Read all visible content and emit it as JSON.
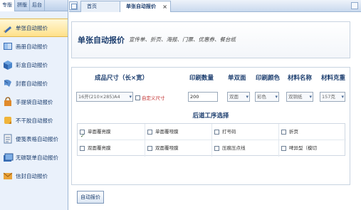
{
  "sidebar": {
    "tabs": [
      {
        "label": "专版"
      },
      {
        "label": "拼版"
      },
      {
        "label": "后台"
      }
    ],
    "items": [
      {
        "label": "单张自动报价",
        "icon": "pencil-icon",
        "active": true
      },
      {
        "label": "画册自动报价",
        "icon": "book-icon"
      },
      {
        "label": "彩盒自动报价",
        "icon": "color-box-icon"
      },
      {
        "label": "封套自动报价",
        "icon": "envelope-icon"
      },
      {
        "label": "手提袋自动报价",
        "icon": "handbag-icon"
      },
      {
        "label": "不干胶自动报价",
        "icon": "sticker-icon"
      },
      {
        "label": "便笺表格自动报价",
        "icon": "notepad-icon"
      },
      {
        "label": "无碳联单自动报价",
        "icon": "carbonless-form-icon"
      },
      {
        "label": "信封自动报价",
        "icon": "letter-envelope-icon"
      }
    ]
  },
  "tabs": [
    {
      "label": "首页"
    },
    {
      "label": "单张自动报价",
      "active": true
    }
  ],
  "page": {
    "title": "单张自动报价",
    "subtitle": "宣传单、折页、海报、门票、优惠券、餐台纸"
  },
  "form": {
    "columns": {
      "size": "成品尺寸（长×宽）",
      "quantity": "印刷数量",
      "sides": "单双面",
      "color": "印刷颜色",
      "material": "材料名称",
      "weight": "材料克重"
    },
    "size_value": "16开(210×285)A4",
    "custom_size_label": "自定义尺寸",
    "quantity_value": "200",
    "sides_value": "双面",
    "color_value": "彩色",
    "material_value": "双铜纸",
    "weight_value": "157克"
  },
  "post_process": {
    "title": "后道工序选择",
    "options": [
      {
        "label": "单面覆亮膜",
        "checked": true
      },
      {
        "label": "单面覆哑膜",
        "checked": false
      },
      {
        "label": "打号码",
        "checked": false
      },
      {
        "label": "折页",
        "checked": false
      },
      {
        "label": "双面覆亮膜",
        "checked": false
      },
      {
        "label": "双面覆哑膜",
        "checked": false
      },
      {
        "label": "压痕压点线",
        "checked": false
      },
      {
        "label": "啤异型（模切",
        "checked": false
      }
    ]
  },
  "actions": {
    "auto_quote": "自动报价"
  },
  "colors": {
    "sidebar_bg": "#eaf1fb",
    "accent": "#1b3d6e",
    "active_item": "#ffe18a",
    "custom_size_text": "#c23030"
  }
}
